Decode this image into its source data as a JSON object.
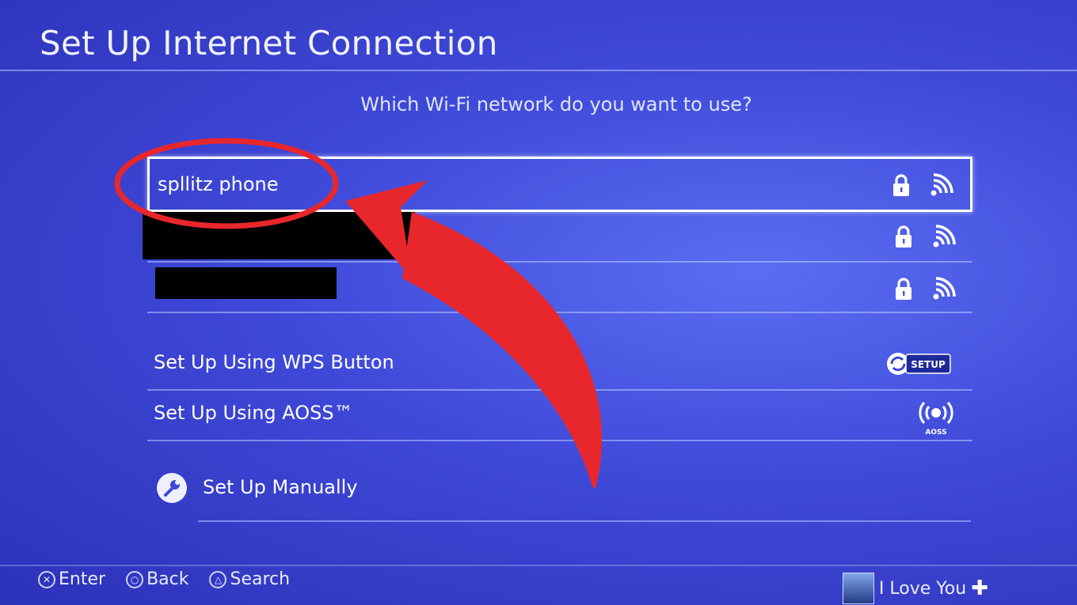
{
  "header": {
    "title": "Set Up Internet Connection",
    "question": "Which Wi-Fi network do you want to use?"
  },
  "networks": [
    {
      "name": "spllitz phone",
      "icons": [
        "lock-icon",
        "wifi-signal-icon"
      ],
      "focused": true
    },
    {
      "name": "",
      "redacted": true,
      "icons": [
        "lock-icon",
        "wifi-signal-icon"
      ]
    },
    {
      "name": "",
      "redacted": true,
      "icons": [
        "lock-icon",
        "wifi-signal-icon"
      ]
    }
  ],
  "options": {
    "wps_label": "Set Up Using WPS Button",
    "wps_badge": "SETUP",
    "aoss_label": "Set Up Using AOSS™",
    "aoss_badge": "AOSS",
    "manual_label": "Set Up Manually"
  },
  "footer": {
    "enter": "Enter",
    "back": "Back",
    "search": "Search",
    "user_name": "I Love You"
  },
  "colors": {
    "background": "#3f49d8",
    "annotation": "#e8272d",
    "text": "#ffffff"
  }
}
